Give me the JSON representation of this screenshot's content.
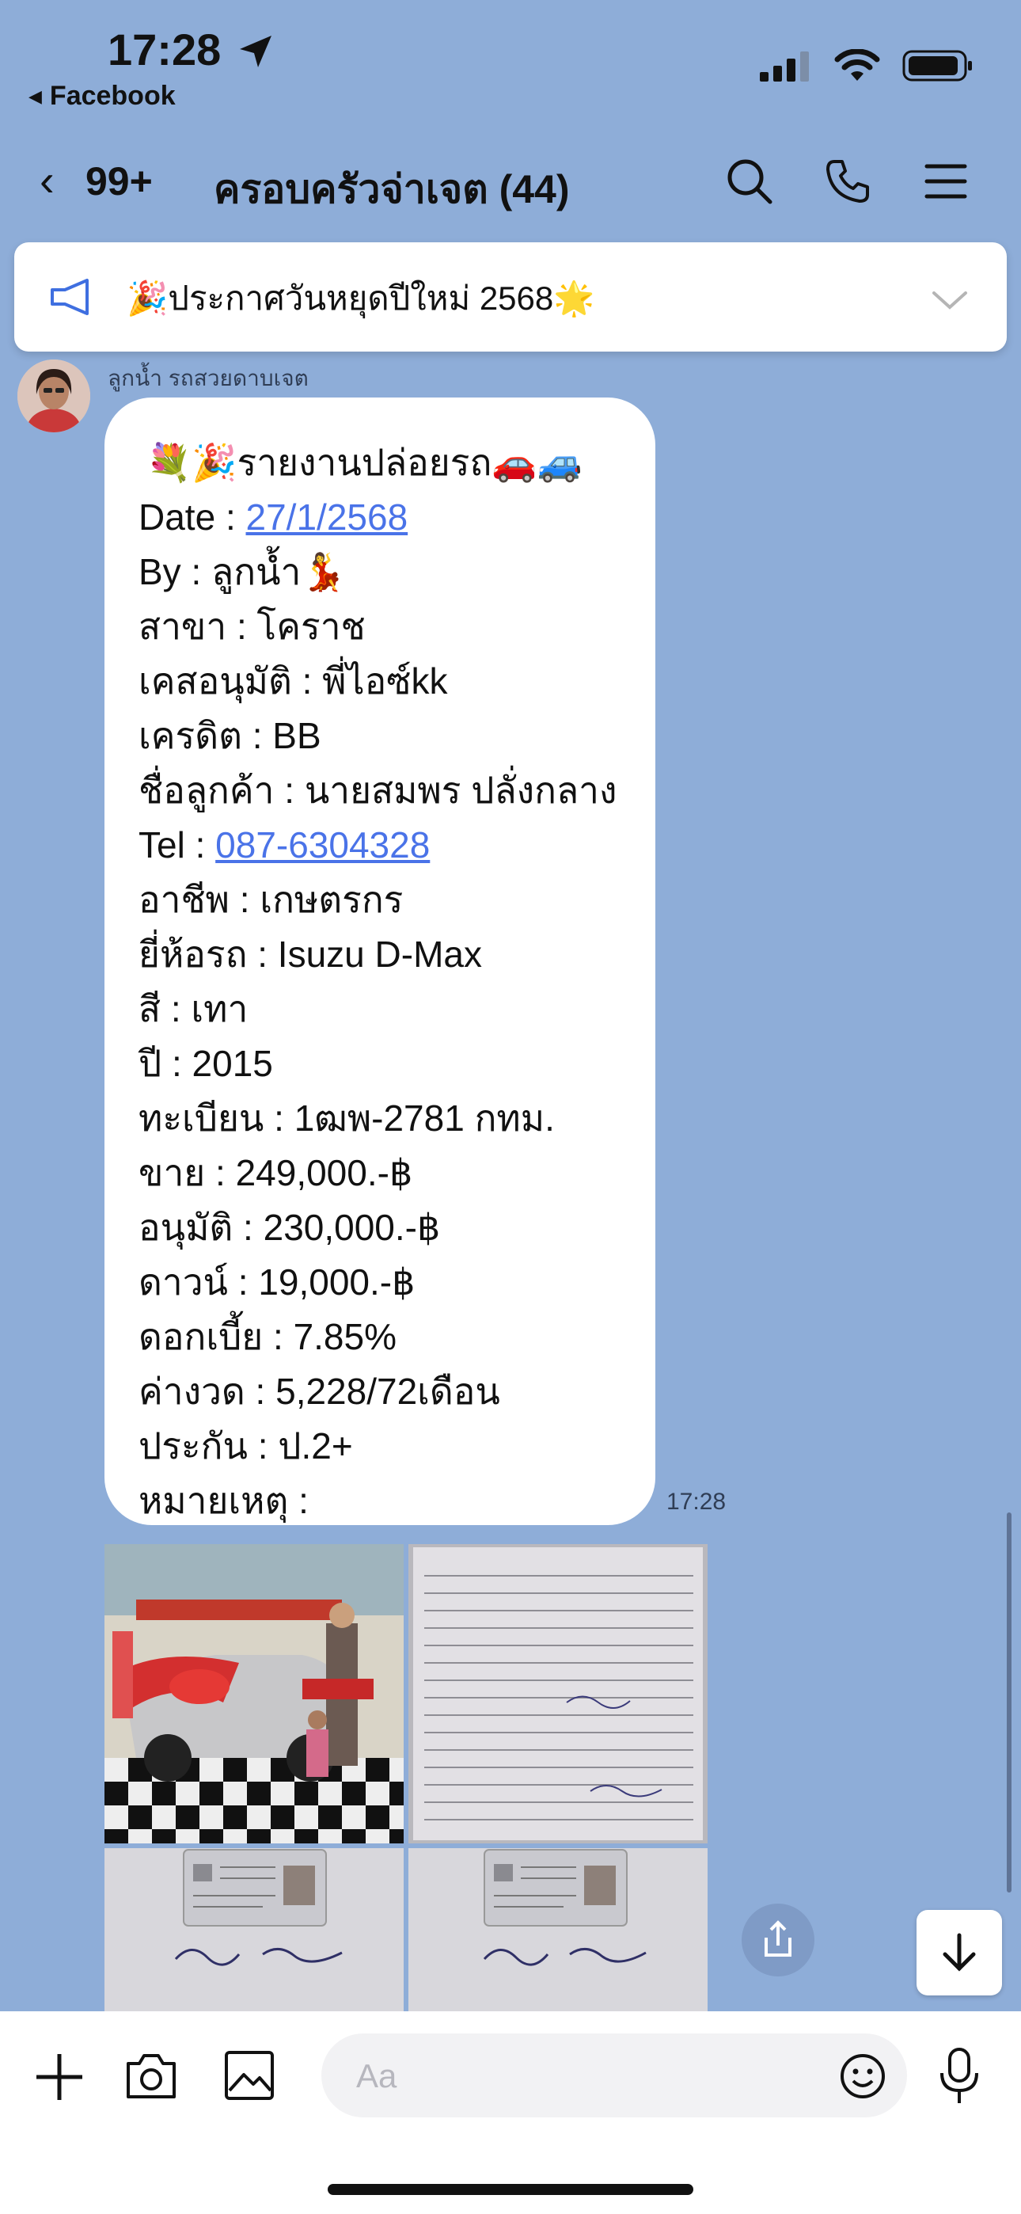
{
  "status": {
    "time": "17:28",
    "back_app": "Facebook"
  },
  "header": {
    "back_count": "99+",
    "title": "ครอบครัวจ่าเจต (44)"
  },
  "announcement": {
    "text": "🎉ประกาศวันหยุดปีใหม่ 2568🌟"
  },
  "message": {
    "sender": "ลูกน้ำ รถสวยดาบเจต",
    "title": "💐🎉รายงานปล่อยรถ🚗🚙",
    "date_label": "Date : ",
    "date_value": "27/1/2568",
    "by": "By : ลูกน้ำ💃",
    "branch": "สาขา : โคราช",
    "approver": "เคสอนุมัติ : พี่ไอซ์kk",
    "credit": "เครดิต : BB",
    "customer": "ชื่อลูกค้า : นายสมพร ปลั่งกลาง",
    "tel_label": "Tel : ",
    "tel_value": "087-6304328",
    "career": "อาชีพ : เกษตรกร",
    "brand": "ยี่ห้อรถ : Isuzu D-Max",
    "color": "สี : เทา",
    "year": "ปี : 2015",
    "plate": "ทะเบียน : 1ฒพ-2781 กทม.",
    "sale": "ขาย : 249,000.-฿",
    "approved": "อนุมัติ : 230,000.-฿",
    "down": "ดาวน์ : 19,000.-฿",
    "interest": "ดอกเบี้ย : 7.85%",
    "installment": "ค่างวด : 5,228/72เดือน",
    "insurance": "ประกัน : ป.2+",
    "note": "หมายเหตุ :",
    "time": "17:28"
  },
  "input": {
    "placeholder": "Aa"
  },
  "colors": {
    "chat_bg": "#8eadd8",
    "link": "#4a73e8",
    "bubble": "#ffffff"
  }
}
